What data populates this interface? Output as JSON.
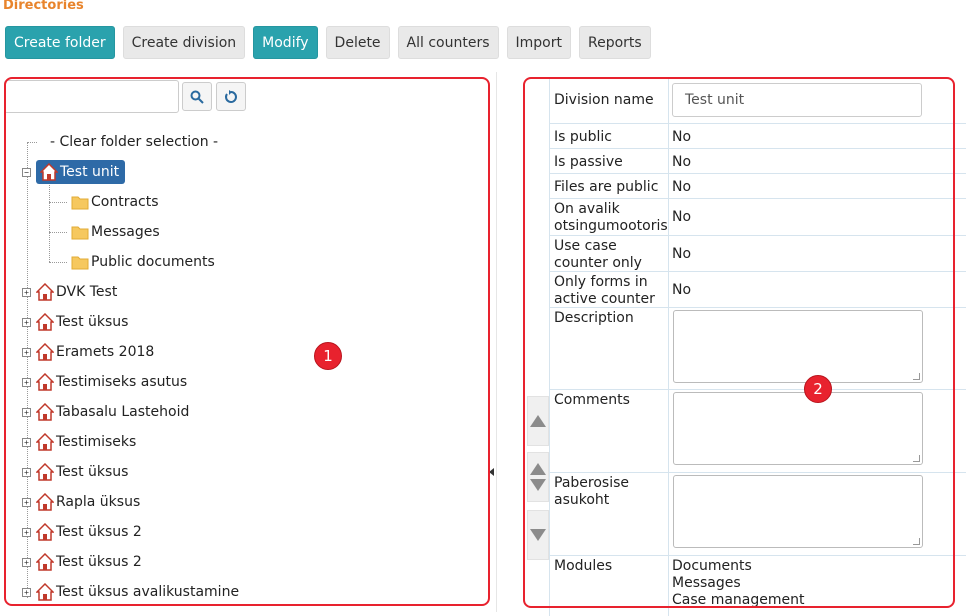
{
  "page": {
    "title": "Directories"
  },
  "toolbar": {
    "create_folder": "Create folder",
    "create_division": "Create division",
    "modify": "Modify",
    "delete": "Delete",
    "all_counters": "All counters",
    "import": "Import",
    "reports": "Reports"
  },
  "search": {
    "value": "",
    "placeholder": ""
  },
  "tree": {
    "clear_label": "- Clear folder selection -",
    "selected": "Test unit",
    "children": [
      "Contracts",
      "Messages",
      "Public documents"
    ],
    "nodes": [
      "DVK Test",
      "Test üksus",
      "Eramets 2018",
      "Testimiseks asutus",
      "Tabasalu Lastehoid",
      "Testimiseks",
      "Test üksus",
      "Rapla üksus",
      "Test üksus 2",
      "Test üksus 2",
      "Test üksus avalikustamine"
    ]
  },
  "props": {
    "division_name_label": "Division name",
    "division_name_value": "Test unit",
    "is_public_label": "Is public",
    "is_public_value": "No",
    "is_passive_label": "Is passive",
    "is_passive_value": "No",
    "files_public_label": "Files are public",
    "files_public_value": "No",
    "on_avalik_label_1": "On avalik",
    "on_avalik_label_2": "otsingumootoris",
    "on_avalik_value": "No",
    "use_case_label_1": "Use case",
    "use_case_label_2": "counter only",
    "use_case_value": "No",
    "only_forms_label_1": "Only forms in",
    "only_forms_label_2": "active counter",
    "only_forms_value": "No",
    "description_label": "Description",
    "comments_label": "Comments",
    "paberosise_label_1": "Paberosise",
    "paberosise_label_2": "asukoht",
    "modules_label": "Modules",
    "modules": [
      "Documents",
      "Messages",
      "Case management"
    ]
  },
  "annotations": {
    "one": "1",
    "two": "2"
  },
  "colors": {
    "primary": "#2aa2ad",
    "title": "#e8842c",
    "callout": "#e8222e",
    "selected": "#2e6aa7"
  }
}
